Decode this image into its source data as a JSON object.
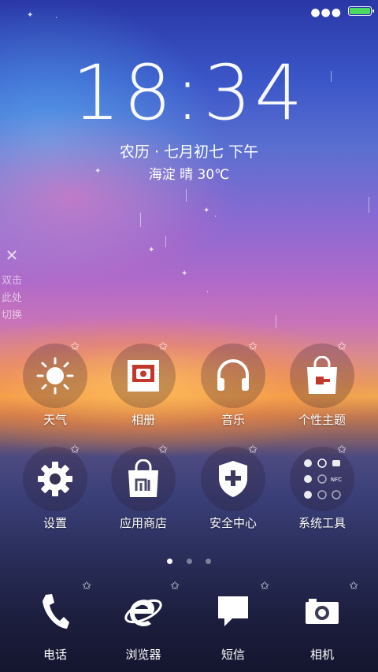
{
  "status": {
    "battery_level": 1.0,
    "battery_color": "#4cd964",
    "overflow_icon": "more-dots-icon"
  },
  "clock": {
    "time": "18:34"
  },
  "date": {
    "lunar": "农历 · 七月初七  下午"
  },
  "weather": {
    "summary": "海淀  晴  30℃"
  },
  "side_hint": {
    "text": "双击此处切换",
    "close_icon": "close-icon"
  },
  "apps": [
    {
      "label": "天气",
      "icon": "sun-icon"
    },
    {
      "label": "相册",
      "icon": "photo-icon"
    },
    {
      "label": "音乐",
      "icon": "headphones-icon"
    },
    {
      "label": "个性主题",
      "icon": "theme-bag-icon"
    },
    {
      "label": "设置",
      "icon": "gear-icon"
    },
    {
      "label": "应用商店",
      "icon": "mi-store-bag-icon"
    },
    {
      "label": "安全中心",
      "icon": "shield-plus-icon"
    },
    {
      "label": "系统工具",
      "icon": "tools-folder-icon"
    }
  ],
  "pages": {
    "count": 3,
    "current": 1
  },
  "dock": [
    {
      "label": "电话",
      "icon": "phone-icon"
    },
    {
      "label": "浏览器",
      "icon": "browser-e-icon"
    },
    {
      "label": "短信",
      "icon": "message-icon"
    },
    {
      "label": "相机",
      "icon": "camera-icon"
    }
  ]
}
